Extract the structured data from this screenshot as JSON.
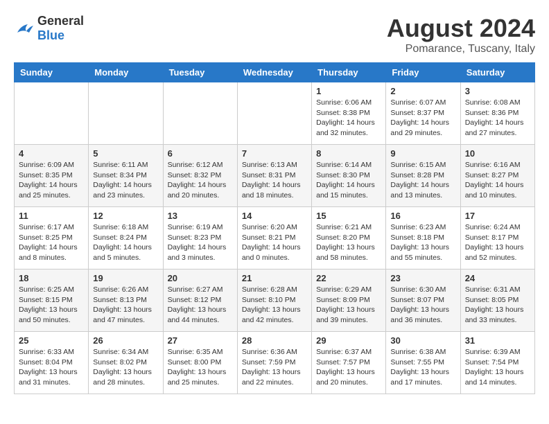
{
  "logo": {
    "general": "General",
    "blue": "Blue"
  },
  "title": "August 2024",
  "subtitle": "Pomarance, Tuscany, Italy",
  "days_of_week": [
    "Sunday",
    "Monday",
    "Tuesday",
    "Wednesday",
    "Thursday",
    "Friday",
    "Saturday"
  ],
  "weeks": [
    [
      {
        "day": "",
        "sunrise": "",
        "sunset": "",
        "daylight": ""
      },
      {
        "day": "",
        "sunrise": "",
        "sunset": "",
        "daylight": ""
      },
      {
        "day": "",
        "sunrise": "",
        "sunset": "",
        "daylight": ""
      },
      {
        "day": "",
        "sunrise": "",
        "sunset": "",
        "daylight": ""
      },
      {
        "day": "1",
        "sunrise": "Sunrise: 6:06 AM",
        "sunset": "Sunset: 8:38 PM",
        "daylight": "Daylight: 14 hours and 32 minutes."
      },
      {
        "day": "2",
        "sunrise": "Sunrise: 6:07 AM",
        "sunset": "Sunset: 8:37 PM",
        "daylight": "Daylight: 14 hours and 29 minutes."
      },
      {
        "day": "3",
        "sunrise": "Sunrise: 6:08 AM",
        "sunset": "Sunset: 8:36 PM",
        "daylight": "Daylight: 14 hours and 27 minutes."
      }
    ],
    [
      {
        "day": "4",
        "sunrise": "Sunrise: 6:09 AM",
        "sunset": "Sunset: 8:35 PM",
        "daylight": "Daylight: 14 hours and 25 minutes."
      },
      {
        "day": "5",
        "sunrise": "Sunrise: 6:11 AM",
        "sunset": "Sunset: 8:34 PM",
        "daylight": "Daylight: 14 hours and 23 minutes."
      },
      {
        "day": "6",
        "sunrise": "Sunrise: 6:12 AM",
        "sunset": "Sunset: 8:32 PM",
        "daylight": "Daylight: 14 hours and 20 minutes."
      },
      {
        "day": "7",
        "sunrise": "Sunrise: 6:13 AM",
        "sunset": "Sunset: 8:31 PM",
        "daylight": "Daylight: 14 hours and 18 minutes."
      },
      {
        "day": "8",
        "sunrise": "Sunrise: 6:14 AM",
        "sunset": "Sunset: 8:30 PM",
        "daylight": "Daylight: 14 hours and 15 minutes."
      },
      {
        "day": "9",
        "sunrise": "Sunrise: 6:15 AM",
        "sunset": "Sunset: 8:28 PM",
        "daylight": "Daylight: 14 hours and 13 minutes."
      },
      {
        "day": "10",
        "sunrise": "Sunrise: 6:16 AM",
        "sunset": "Sunset: 8:27 PM",
        "daylight": "Daylight: 14 hours and 10 minutes."
      }
    ],
    [
      {
        "day": "11",
        "sunrise": "Sunrise: 6:17 AM",
        "sunset": "Sunset: 8:25 PM",
        "daylight": "Daylight: 14 hours and 8 minutes."
      },
      {
        "day": "12",
        "sunrise": "Sunrise: 6:18 AM",
        "sunset": "Sunset: 8:24 PM",
        "daylight": "Daylight: 14 hours and 5 minutes."
      },
      {
        "day": "13",
        "sunrise": "Sunrise: 6:19 AM",
        "sunset": "Sunset: 8:23 PM",
        "daylight": "Daylight: 14 hours and 3 minutes."
      },
      {
        "day": "14",
        "sunrise": "Sunrise: 6:20 AM",
        "sunset": "Sunset: 8:21 PM",
        "daylight": "Daylight: 14 hours and 0 minutes."
      },
      {
        "day": "15",
        "sunrise": "Sunrise: 6:21 AM",
        "sunset": "Sunset: 8:20 PM",
        "daylight": "Daylight: 13 hours and 58 minutes."
      },
      {
        "day": "16",
        "sunrise": "Sunrise: 6:23 AM",
        "sunset": "Sunset: 8:18 PM",
        "daylight": "Daylight: 13 hours and 55 minutes."
      },
      {
        "day": "17",
        "sunrise": "Sunrise: 6:24 AM",
        "sunset": "Sunset: 8:17 PM",
        "daylight": "Daylight: 13 hours and 52 minutes."
      }
    ],
    [
      {
        "day": "18",
        "sunrise": "Sunrise: 6:25 AM",
        "sunset": "Sunset: 8:15 PM",
        "daylight": "Daylight: 13 hours and 50 minutes."
      },
      {
        "day": "19",
        "sunrise": "Sunrise: 6:26 AM",
        "sunset": "Sunset: 8:13 PM",
        "daylight": "Daylight: 13 hours and 47 minutes."
      },
      {
        "day": "20",
        "sunrise": "Sunrise: 6:27 AM",
        "sunset": "Sunset: 8:12 PM",
        "daylight": "Daylight: 13 hours and 44 minutes."
      },
      {
        "day": "21",
        "sunrise": "Sunrise: 6:28 AM",
        "sunset": "Sunset: 8:10 PM",
        "daylight": "Daylight: 13 hours and 42 minutes."
      },
      {
        "day": "22",
        "sunrise": "Sunrise: 6:29 AM",
        "sunset": "Sunset: 8:09 PM",
        "daylight": "Daylight: 13 hours and 39 minutes."
      },
      {
        "day": "23",
        "sunrise": "Sunrise: 6:30 AM",
        "sunset": "Sunset: 8:07 PM",
        "daylight": "Daylight: 13 hours and 36 minutes."
      },
      {
        "day": "24",
        "sunrise": "Sunrise: 6:31 AM",
        "sunset": "Sunset: 8:05 PM",
        "daylight": "Daylight: 13 hours and 33 minutes."
      }
    ],
    [
      {
        "day": "25",
        "sunrise": "Sunrise: 6:33 AM",
        "sunset": "Sunset: 8:04 PM",
        "daylight": "Daylight: 13 hours and 31 minutes."
      },
      {
        "day": "26",
        "sunrise": "Sunrise: 6:34 AM",
        "sunset": "Sunset: 8:02 PM",
        "daylight": "Daylight: 13 hours and 28 minutes."
      },
      {
        "day": "27",
        "sunrise": "Sunrise: 6:35 AM",
        "sunset": "Sunset: 8:00 PM",
        "daylight": "Daylight: 13 hours and 25 minutes."
      },
      {
        "day": "28",
        "sunrise": "Sunrise: 6:36 AM",
        "sunset": "Sunset: 7:59 PM",
        "daylight": "Daylight: 13 hours and 22 minutes."
      },
      {
        "day": "29",
        "sunrise": "Sunrise: 6:37 AM",
        "sunset": "Sunset: 7:57 PM",
        "daylight": "Daylight: 13 hours and 20 minutes."
      },
      {
        "day": "30",
        "sunrise": "Sunrise: 6:38 AM",
        "sunset": "Sunset: 7:55 PM",
        "daylight": "Daylight: 13 hours and 17 minutes."
      },
      {
        "day": "31",
        "sunrise": "Sunrise: 6:39 AM",
        "sunset": "Sunset: 7:54 PM",
        "daylight": "Daylight: 13 hours and 14 minutes."
      }
    ]
  ]
}
